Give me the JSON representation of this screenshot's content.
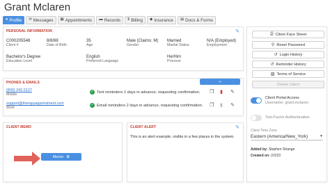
{
  "client": {
    "name": "Grant Mclaren"
  },
  "tabs": [
    {
      "label": "Profile",
      "icon": "user-icon",
      "active": true
    },
    {
      "label": "Messages",
      "icon": "message-icon"
    },
    {
      "label": "Appointments",
      "icon": "calendar-icon"
    },
    {
      "label": "Records",
      "icon": "folder-icon"
    },
    {
      "label": "Billing",
      "icon": "dollar-icon"
    },
    {
      "label": "Insurance",
      "icon": "shield-icon"
    },
    {
      "label": "Docs & Forms",
      "icon": "document-icon"
    }
  ],
  "personal": {
    "title": "PERSONAL INFORMATION",
    "rows": [
      [
        {
          "value": "C000205548",
          "label": "Client #"
        },
        {
          "value": "8/8/88",
          "label": "Date of Birth"
        },
        {
          "value": "35",
          "label": "Age"
        },
        {
          "value": "Male (Claims: M)",
          "label": "Gender"
        },
        {
          "value": "Married",
          "label": "Marital Status"
        },
        {
          "value": "N/A (Employed)",
          "label": "Employment"
        }
      ],
      [
        {
          "value": "Bachelor's Degree",
          "label": "Education Level"
        },
        {
          "value": "English",
          "label": "Preferred Language"
        },
        {
          "value": "He/Him",
          "label": "Pronoun"
        }
      ]
    ]
  },
  "phones": {
    "title": "PHONES & EMAILS",
    "add_label": "+",
    "items": [
      {
        "value": "(800) 242-2127",
        "label": "Mobile",
        "note": "Text reminders 1 days in advance, requesting confirmation."
      },
      {
        "value": "support@therapyappointment.com",
        "label": "Work",
        "note": "Email reminders 2 days in advance, requesting confirmation."
      }
    ]
  },
  "memo": {
    "title": "CLIENT MEMO",
    "button_label": "Memo"
  },
  "alert": {
    "title": "CLIENT ALERT",
    "text": "This is an alert example, visible in a few places in the system."
  },
  "actions": [
    {
      "label": "Client Face Sheet",
      "icon": "printer-icon"
    },
    {
      "label": "Reset Password",
      "icon": "key-icon"
    },
    {
      "label": "Login History",
      "icon": "history-icon"
    },
    {
      "label": "Reminder History",
      "icon": "history-icon"
    },
    {
      "label": "Terms of Service",
      "icon": "book-icon"
    },
    {
      "label": "Delete Client",
      "icon": "",
      "disabled": true
    }
  ],
  "portal": {
    "label": "Client Portal Access",
    "username_prefix": "Username:",
    "username": "grant.mclaren",
    "two_factor_label": "Two-Factor Authentication"
  },
  "timezone": {
    "label": "Client Time Zone",
    "value": "Eastern (America/New_York)"
  },
  "meta": {
    "added_by_label": "Added by:",
    "added_by": "Stephen Strange",
    "created_on_label": "Created on:",
    "created_on": "2/2/23"
  },
  "colors": {
    "accent": "#4a90e2",
    "section_title": "#c0392b",
    "success": "#2e9e4f",
    "danger": "#d9343b",
    "arrow": "#e0625a"
  }
}
